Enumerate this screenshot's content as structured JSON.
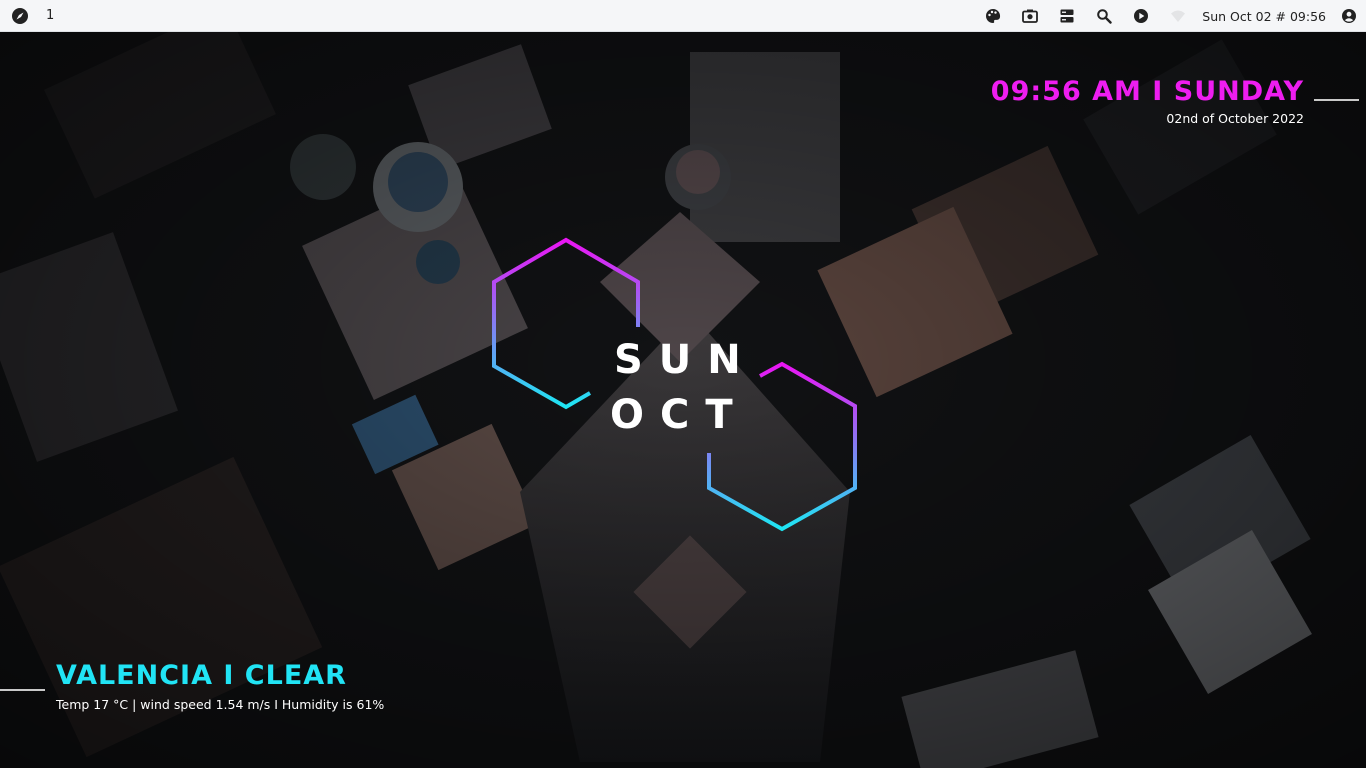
{
  "panel": {
    "launcher_icon": "compass-icon",
    "workspace": "1",
    "tray_icons": [
      "palette-icon",
      "screenshot-camera-icon",
      "storage-icon",
      "search-icon",
      "media-play-icon",
      "wifi-icon"
    ],
    "clock": "Sun Oct 02 # 09:56",
    "user_icon": "user-account-icon"
  },
  "time_widget": {
    "time": "09:56 AM I SUNDAY",
    "date": "02nd of October 2022",
    "color": "#ee1df0"
  },
  "center_widget": {
    "day": "SUN",
    "month": "OCT",
    "gradient_top": "#ea15f3",
    "gradient_bottom": "#1ee6f3"
  },
  "weather_widget": {
    "title": "VALENCIA I CLEAR",
    "info": "Temp 17 °C | wind speed 1.54 m/s I Humidity is 61%",
    "color": "#21e4f5"
  }
}
